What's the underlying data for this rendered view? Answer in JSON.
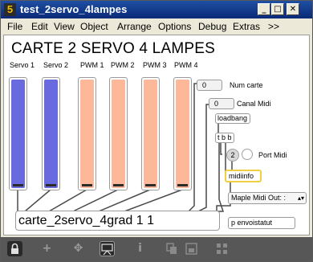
{
  "window": {
    "title": "test_2servo_4lampes",
    "icon_label": "5",
    "controls": [
      "_",
      "□",
      "✕"
    ]
  },
  "menu": [
    "File",
    "Edit",
    "View",
    "Object",
    "Arrange",
    "Options",
    "Debug",
    "Extras",
    ">>"
  ],
  "patcher": {
    "heading": "CARTE 2 SERVO 4 LAMPES",
    "sliders": [
      {
        "label": "Servo 1",
        "color": "#6a6ae0"
      },
      {
        "label": "Servo 2",
        "color": "#6a6ae0"
      },
      {
        "label": "PWM 1",
        "color": "#fcb898"
      },
      {
        "label": "PWM 2",
        "color": "#fcb898"
      },
      {
        "label": "PWM 3",
        "color": "#fcb898"
      },
      {
        "label": "PWM 4",
        "color": "#fcb898"
      }
    ],
    "num_carte": {
      "value": "0",
      "label": "Num carte"
    },
    "canal_midi": {
      "value": "0",
      "label": "Canal Midi"
    },
    "loadbang": "loadbang",
    "tbb": "t b b",
    "port_number": "2",
    "port_label": "Port Midi",
    "midiinfo": "midiinfo",
    "midi_menu": "Maple Midi Out: :",
    "main_object": "carte_2servo_4grad 1 1",
    "envoistatut": "p envoistatut"
  },
  "toolbar": {
    "icons": [
      "lock-icon",
      "add-icon",
      "move-icon",
      "presentation-icon",
      "info-icon",
      "copy-icon",
      "paste-icon",
      "grid-icon"
    ]
  }
}
